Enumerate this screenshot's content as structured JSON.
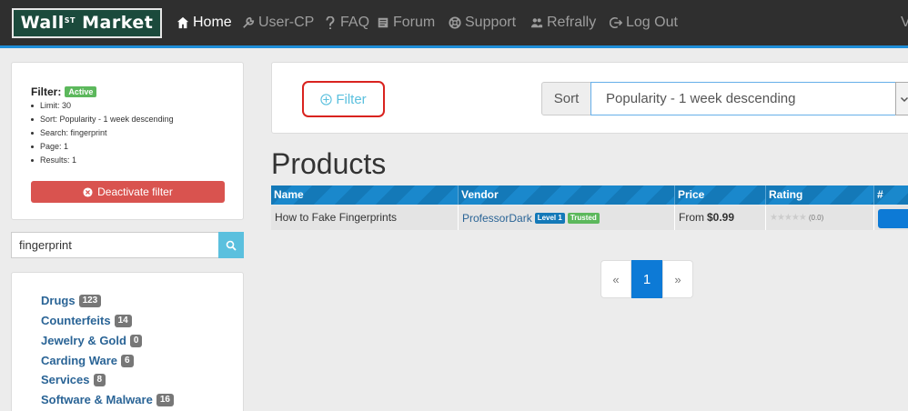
{
  "navbar": {
    "logo": {
      "part1": "Wall",
      "sup": "ST",
      "part2": " Market"
    },
    "items": [
      {
        "label": "Home",
        "icon": "home-icon"
      },
      {
        "label": "User-CP",
        "icon": "wrench-icon"
      },
      {
        "label": "FAQ",
        "icon": "question-icon"
      },
      {
        "label": "Forum",
        "icon": "forum-icon"
      },
      {
        "label": "Support",
        "icon": "lifebuoy-icon"
      },
      {
        "label": "Refrally",
        "icon": "users-icon"
      },
      {
        "label": "Log Out",
        "icon": "logout-icon"
      }
    ],
    "edge_text": "V"
  },
  "filter_panel": {
    "title": "Filter:",
    "status": "Active",
    "items": [
      "Limit: 30",
      "Sort: Popularity - 1 week descending",
      "Search: fingerprint",
      "Page: 1",
      "Results: 1"
    ],
    "deactivate_label": "Deactivate filter"
  },
  "search": {
    "value": "fingerprint"
  },
  "categories": [
    {
      "label": "Drugs",
      "count": "123"
    },
    {
      "label": "Counterfeits",
      "count": "14"
    },
    {
      "label": "Jewelry & Gold",
      "count": "0"
    },
    {
      "label": "Carding Ware",
      "count": "6"
    },
    {
      "label": "Services",
      "count": "8"
    },
    {
      "label": "Software & Malware",
      "count": "16"
    }
  ],
  "toolbar": {
    "filter_label": "Filter",
    "sort_label": "Sort",
    "sort_value": "Popularity - 1 week descending"
  },
  "products": {
    "title": "Products",
    "columns": [
      "Name",
      "Vendor",
      "Price",
      "Rating",
      "#"
    ],
    "rows": [
      {
        "name": "How to Fake Fingerprints",
        "vendor": "ProfessorDark",
        "vendor_level": "Level 1",
        "vendor_trust": "Trusted",
        "price_prefix": "From",
        "price": "$0.99",
        "stars": "★★★★★",
        "rating": "(0.0)"
      }
    ]
  },
  "pagination": {
    "prev": "«",
    "current": "1",
    "next": "»"
  },
  "colors": {
    "nav_bg": "#2f2f2f",
    "accent": "#1e8ed8",
    "danger": "#d9534f",
    "success": "#5cb85c",
    "primary": "#0d7ad6"
  }
}
